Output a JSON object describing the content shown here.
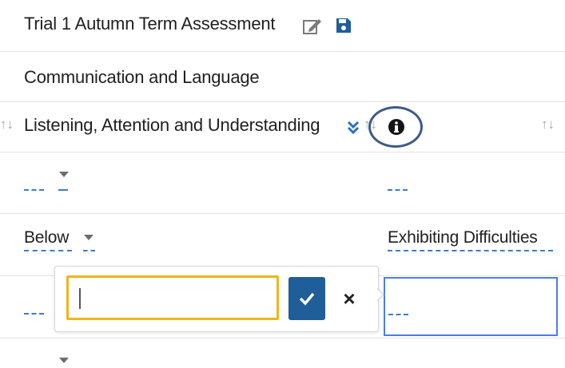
{
  "assessment": {
    "title": "Trial 1 Autumn Term Assessment",
    "subject": "Communication and Language",
    "strand": "Listening, Attention and Understanding"
  },
  "sort_glyph": "↑↓",
  "rows": [
    {
      "left_value": "",
      "right_value": ""
    },
    {
      "left_value": "Below",
      "right_value": "Exhibiting Difficulties"
    },
    {
      "left_value": "",
      "right_value": ""
    }
  ],
  "edit_popup": {
    "input_value": "",
    "confirm_label": "✓",
    "cancel_label": "×"
  },
  "colors": {
    "link_blue": "#3d7cc9",
    "accent_navy": "#1f5e99",
    "focus_yellow": "#f0b51b",
    "active_cell": "#4a7ee8"
  }
}
